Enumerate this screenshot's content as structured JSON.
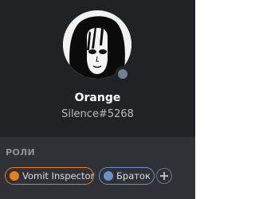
{
  "profile": {
    "username": "Orange",
    "discriminator_line": "Silence#5268",
    "status": "offline"
  },
  "roles_section": {
    "title": "РОЛИ",
    "roles": [
      {
        "name": "Vomit Inspector",
        "color": "#e67e22"
      },
      {
        "name": "Браток",
        "color": "#6b8fc7"
      }
    ],
    "add_icon": "plus-icon"
  },
  "colors": {
    "header_bg": "#202225",
    "body_bg": "#2f3136",
    "status_offline": "#747f8d"
  }
}
